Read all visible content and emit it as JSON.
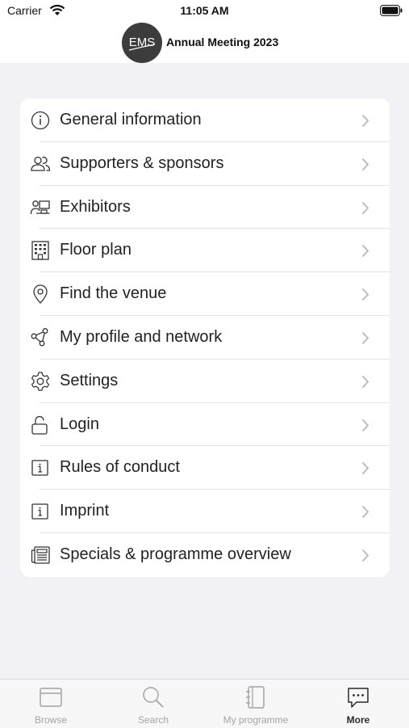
{
  "status": {
    "carrier": "Carrier",
    "time": "11:05 AM"
  },
  "header": {
    "logo_text": "EMS",
    "title": "Annual Meeting 2023"
  },
  "menu": {
    "items": [
      {
        "label": "General information",
        "icon": "info-circle-icon"
      },
      {
        "label": "Supporters & sponsors",
        "icon": "people-icon"
      },
      {
        "label": "Exhibitors",
        "icon": "exhibitor-icon"
      },
      {
        "label": "Floor plan",
        "icon": "building-icon"
      },
      {
        "label": "Find the venue",
        "icon": "location-pin-icon"
      },
      {
        "label": "My profile and network",
        "icon": "network-icon"
      },
      {
        "label": "Settings",
        "icon": "gear-icon"
      },
      {
        "label": "Login",
        "icon": "unlock-icon"
      },
      {
        "label": "Rules of conduct",
        "icon": "info-square-icon"
      },
      {
        "label": "Imprint",
        "icon": "info-square-icon"
      },
      {
        "label": "Specials & programme overview",
        "icon": "newspaper-icon"
      }
    ]
  },
  "tabbar": {
    "tabs": [
      {
        "label": "Browse",
        "icon": "browser-icon",
        "active": false
      },
      {
        "label": "Search",
        "icon": "magnifier-icon",
        "active": false
      },
      {
        "label": "My programme",
        "icon": "notebook-icon",
        "active": false
      },
      {
        "label": "More",
        "icon": "chat-dots-icon",
        "active": true
      }
    ]
  },
  "colors": {
    "background": "#f2f2f6",
    "card": "#ffffff",
    "text": "#222222",
    "inactive_tab": "#a4a4a4"
  }
}
